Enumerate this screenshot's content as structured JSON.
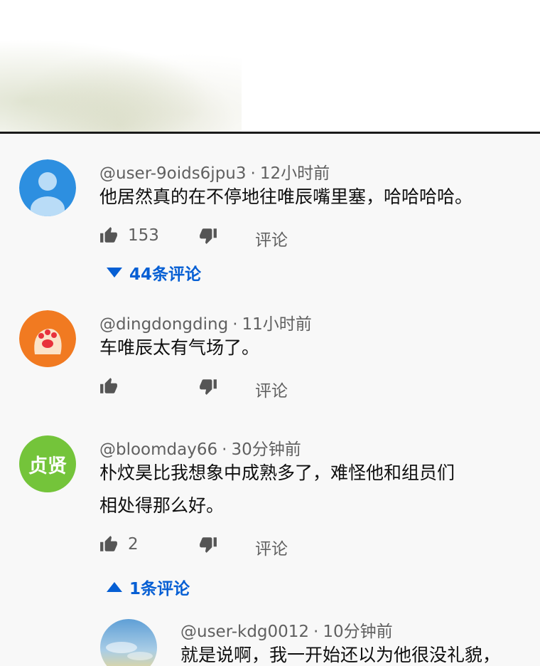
{
  "comments": [
    {
      "user": "@user-9oids6jpu3",
      "time": "12小时前",
      "text": "他居然真的在不停地往唯辰嘴里塞，哈哈哈哈。",
      "likes": "153",
      "reply_label": "评论",
      "replies_label": "44条评论",
      "avatar_color": "#2d8fe0"
    },
    {
      "user": "@dingdongding",
      "time": "11小时前",
      "text": "车唯辰太有气场了。",
      "likes": "",
      "reply_label": "评论",
      "avatar_color": "#f17a21"
    },
    {
      "user": "@bloomday66",
      "time": "30分钟前",
      "text_line1": "朴炆昊比我想象中成熟多了，难怪他和组员们",
      "text_line2": "相处得那么好。",
      "likes": "2",
      "reply_label": "评论",
      "replies_label": "1条评论",
      "avatar_text": "贞贤",
      "avatar_color": "#74c43a"
    }
  ],
  "reply": {
    "user": "@user-kdg0012",
    "time": "10分钟前",
    "text": "就是说啊，我一开始还以为他很没礼貌，"
  },
  "colors": {
    "link": "#065fd4",
    "muted": "#606060",
    "panel_bg": "#f8f8f8"
  }
}
